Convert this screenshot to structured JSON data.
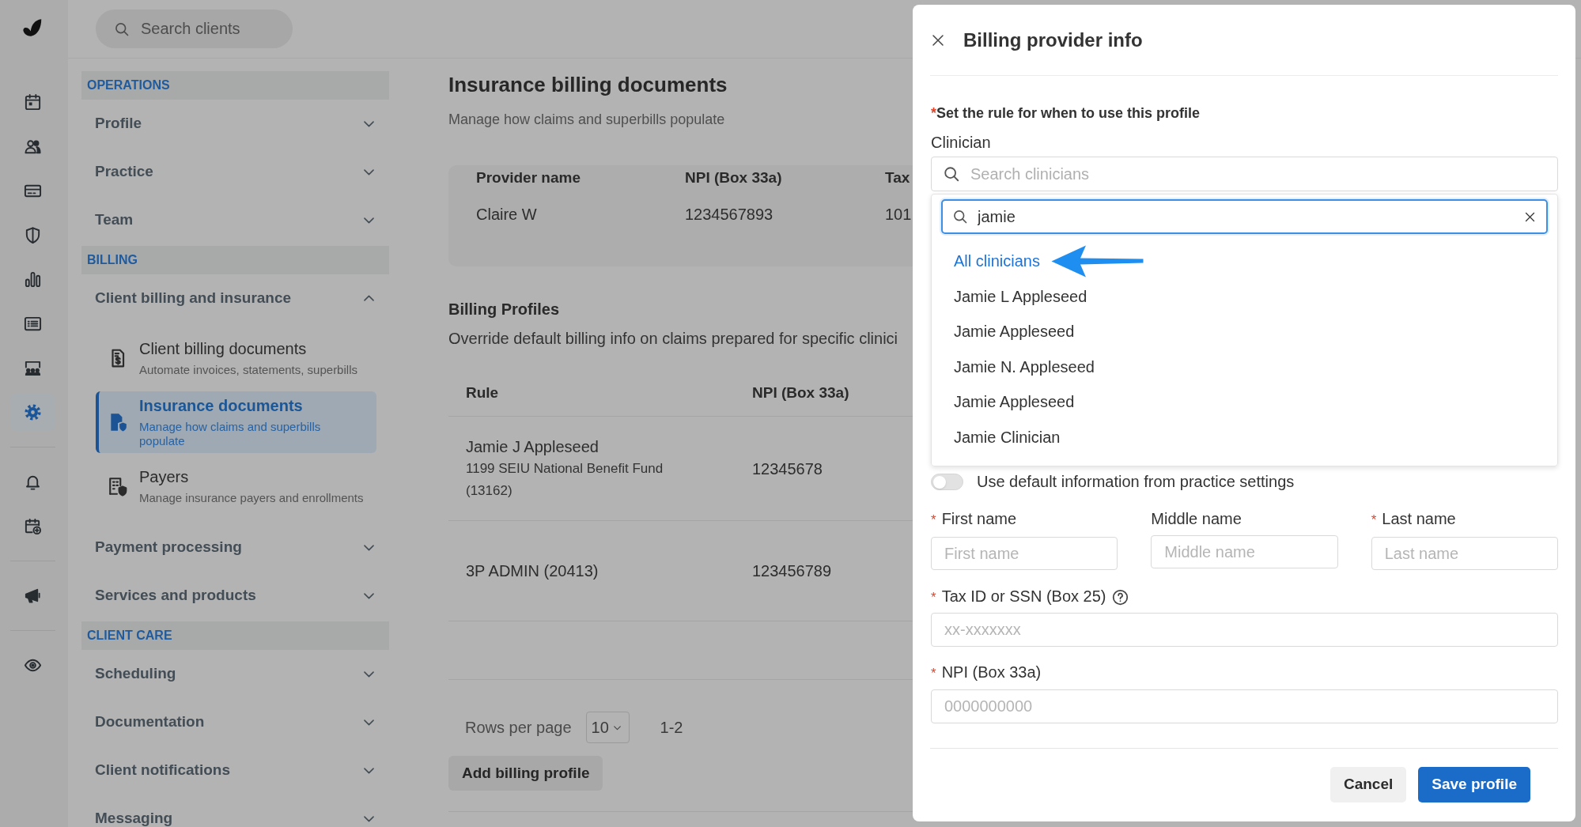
{
  "rail": {
    "groups": [
      {
        "items": [
          {
            "kind": "calendar",
            "selected": false
          },
          {
            "kind": "people",
            "selected": false
          },
          {
            "kind": "card",
            "selected": false
          },
          {
            "kind": "shield",
            "selected": false
          },
          {
            "kind": "chart",
            "selected": false
          },
          {
            "kind": "list",
            "selected": false
          },
          {
            "kind": "group",
            "selected": false
          },
          {
            "kind": "gear",
            "selected": true
          }
        ]
      },
      {
        "items": [
          {
            "kind": "bell",
            "selected": false
          },
          {
            "kind": "calendar_plus",
            "selected": false
          }
        ]
      },
      {
        "items": [
          {
            "kind": "megaphone",
            "selected": false
          }
        ]
      },
      {
        "items": [
          {
            "kind": "eye",
            "selected": false
          }
        ]
      }
    ]
  },
  "top_bar": {
    "search": {
      "placeholder": "Search clients"
    }
  },
  "sidebar": {
    "sections": [
      {
        "title": "OPERATIONS",
        "items": [
          {
            "label": "Profile",
            "expanded": false
          },
          {
            "label": "Practice",
            "expanded": false
          },
          {
            "label": "Team",
            "expanded": false
          }
        ]
      },
      {
        "title": "BILLING",
        "items": [
          {
            "label": "Client billing and insurance",
            "expanded": true,
            "children": [
              {
                "kind": "invoice",
                "title": "Client billing documents",
                "description": "Automate invoices, statements, superbills",
                "selected": false
              },
              {
                "kind": "insurance",
                "title": "Insurance documents",
                "description": "Manage how claims and superbills populate",
                "selected": true
              },
              {
                "kind": "payers",
                "title": "Payers",
                "description": "Manage insurance payers and enrollments",
                "selected": false
              }
            ]
          },
          {
            "label": "Payment processing",
            "expanded": false
          },
          {
            "label": "Services and products",
            "expanded": false
          }
        ]
      },
      {
        "title": "CLIENT CARE",
        "items": [
          {
            "label": "Scheduling",
            "expanded": false
          },
          {
            "label": "Documentation",
            "expanded": false
          },
          {
            "label": "Client notifications",
            "expanded": false
          },
          {
            "label": "Messaging",
            "expanded": false
          }
        ]
      }
    ]
  },
  "page": {
    "title": "Insurance billing documents",
    "subtitle": "Manage how claims and superbills populate",
    "provider_table": {
      "columns": [
        "Provider name",
        "NPI (Box 33a)",
        "Tax"
      ],
      "rows": [
        [
          "Claire W",
          "1234567893",
          "101"
        ]
      ]
    },
    "billing_profiles": {
      "title": "Billing Profiles",
      "description": "Override default billing info on claims prepared for specific clinici",
      "columns": [
        "Rule",
        "NPI (Box 33a)"
      ],
      "rows": [
        {
          "rule": "Jamie J Appleseed",
          "rule_detail": "1199 SEIU National Benefit Fund (13162)",
          "npi": "12345678"
        },
        {
          "rule": "3P ADMIN (20413)",
          "npi": "123456789"
        }
      ],
      "pagination": {
        "label": "Rows per page",
        "value": "10",
        "range": "1-2"
      },
      "add_button": "Add billing profile"
    }
  },
  "drawer": {
    "title": "Billing provider info",
    "rule_heading": {
      "required_mark": "*",
      "text": "Set the rule for when to use this profile"
    },
    "clinician": {
      "label": "Clinician",
      "placeholder": "Search clinicians",
      "dropdown": {
        "query": "jamie",
        "options": [
          {
            "label": "All clinicians",
            "selected": true
          },
          {
            "label": "Jamie L Appleseed",
            "selected": false
          },
          {
            "label": "Jamie Appleseed",
            "selected": false
          },
          {
            "label": "Jamie N. Appleseed",
            "selected": false
          },
          {
            "label": "Jamie Appleseed",
            "selected": false
          },
          {
            "label": "Jamie Clinician",
            "selected": false
          }
        ]
      }
    },
    "default_toggle": {
      "label": "Use default information from practice settings",
      "on": false
    },
    "name_fields": [
      {
        "required_mark": "*",
        "label": "First name",
        "placeholder": "First name"
      },
      {
        "label": "Middle name",
        "placeholder": "Middle name"
      },
      {
        "required_mark": "*",
        "label": "Last name",
        "placeholder": "Last name"
      }
    ],
    "fields": [
      {
        "required_mark": "*",
        "label": "Tax ID or SSN (Box 25)",
        "help": true,
        "placeholder": "xx-xxxxxxx"
      },
      {
        "required_mark": "*",
        "label": "NPI (Box 33a)",
        "help": false,
        "placeholder": "0000000000"
      }
    ],
    "buttons": [
      {
        "label": "Cancel",
        "kind": "secondary"
      },
      {
        "label": "Save profile",
        "kind": "primary"
      }
    ]
  }
}
